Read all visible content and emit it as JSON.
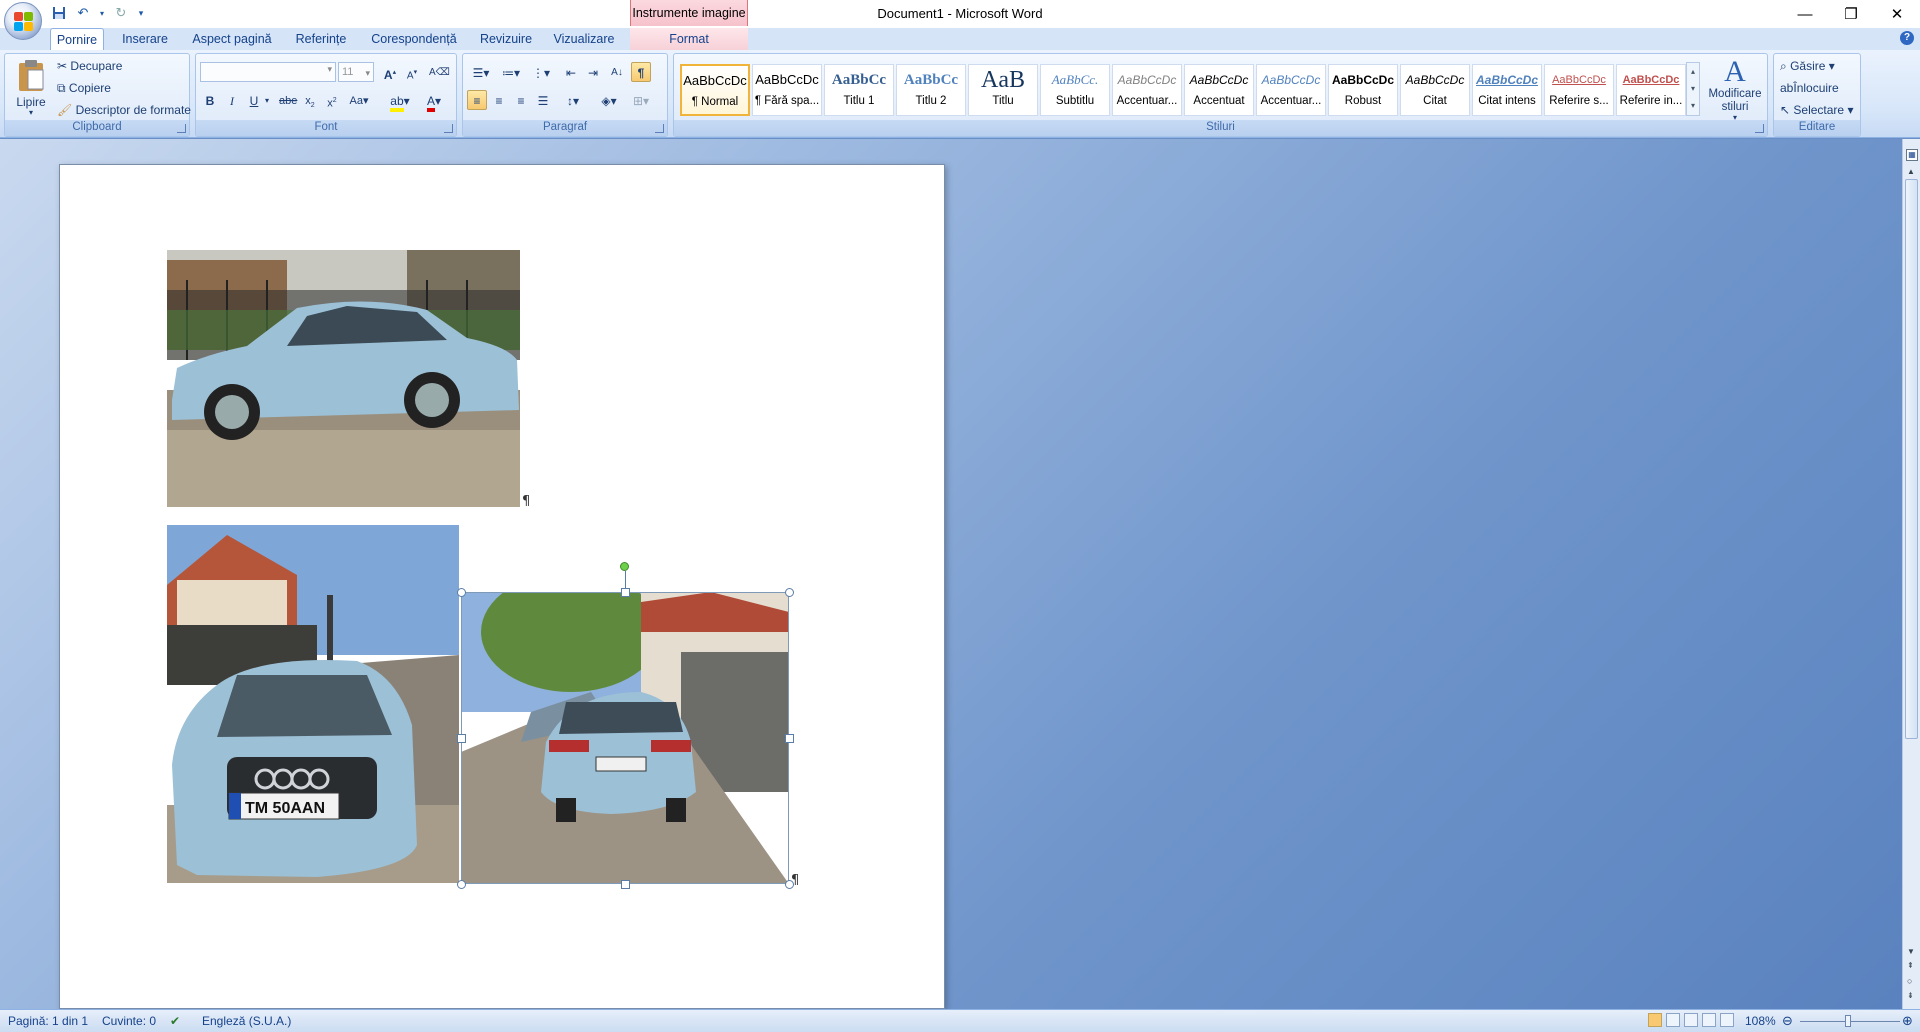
{
  "window": {
    "title": "Document1 - Microsoft Word",
    "contextual_tab": "Instrumente imagine"
  },
  "quick_access": {
    "save_icon": "save-icon",
    "undo_icon": "undo-icon",
    "redo_icon": "redo-icon",
    "customize_icon": "customize-qat-icon"
  },
  "tabs": [
    "Pornire",
    "Inserare",
    "Aspect pagină",
    "Referințe",
    "Corespondență",
    "Revizuire",
    "Vizualizare",
    "Format"
  ],
  "ribbon": {
    "clipboard": {
      "label": "Clipboard",
      "paste": "Lipire",
      "cut": "Decupare",
      "copy": "Copiere",
      "format_painter": "Descriptor de formate"
    },
    "font": {
      "label": "Font",
      "name": "",
      "size": "11"
    },
    "paragraph": {
      "label": "Paragraf"
    },
    "styles": {
      "label": "Stiluri",
      "items": [
        {
          "preview": "AaBbCcDc",
          "name": "¶ Normal"
        },
        {
          "preview": "AaBbCcDc",
          "name": "¶ Fără spa..."
        },
        {
          "preview": "AaBbCc",
          "name": "Titlu 1"
        },
        {
          "preview": "AaBbCc",
          "name": "Titlu 2"
        },
        {
          "preview": "AaB",
          "name": "Titlu"
        },
        {
          "preview": "AaBbCc.",
          "name": "Subtitlu"
        },
        {
          "preview": "AaBbCcDc",
          "name": "Accentuar..."
        },
        {
          "preview": "AaBbCcDc",
          "name": "Accentuat"
        },
        {
          "preview": "AaBbCcDc",
          "name": "Accentuar..."
        },
        {
          "preview": "AaBbCcDc",
          "name": "Robust"
        },
        {
          "preview": "AaBbCcDc",
          "name": "Citat"
        },
        {
          "preview": "AaBbCcDc",
          "name": "Citat intens"
        },
        {
          "preview": "AaBbCcDc",
          "name": "Referire s..."
        },
        {
          "preview": "AaBbCcDc",
          "name": "Referire in..."
        }
      ],
      "change_styles": "Modificare stiluri"
    },
    "editing": {
      "label": "Editare",
      "find": "Găsire",
      "replace": "Înlocuire",
      "select": "Selectare"
    }
  },
  "document": {
    "plate_text": "TM 50AAN",
    "pilcrow": "¶"
  },
  "status": {
    "page": "Pagină: 1 din 1",
    "words": "Cuvinte: 0",
    "language": "Engleză (S.U.A.)",
    "zoom": "108%"
  },
  "colors": {
    "ribbon_blue": "#15428b",
    "car_blue": "#9cc0d6",
    "accent_orange": "#f0b43a"
  }
}
